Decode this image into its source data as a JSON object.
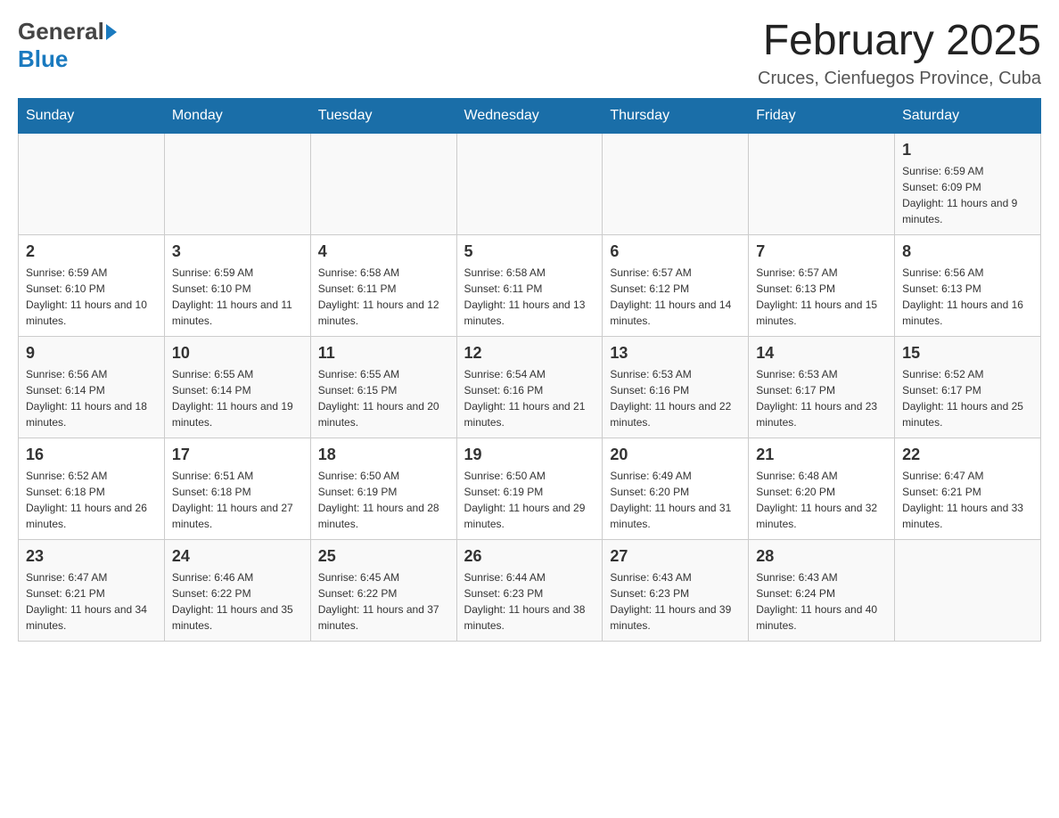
{
  "header": {
    "title": "February 2025",
    "subtitle": "Cruces, Cienfuegos Province, Cuba",
    "logo_general": "General",
    "logo_blue": "Blue"
  },
  "calendar": {
    "days_of_week": [
      "Sunday",
      "Monday",
      "Tuesday",
      "Wednesday",
      "Thursday",
      "Friday",
      "Saturday"
    ],
    "weeks": [
      [
        {
          "day": "",
          "info": ""
        },
        {
          "day": "",
          "info": ""
        },
        {
          "day": "",
          "info": ""
        },
        {
          "day": "",
          "info": ""
        },
        {
          "day": "",
          "info": ""
        },
        {
          "day": "",
          "info": ""
        },
        {
          "day": "1",
          "info": "Sunrise: 6:59 AM\nSunset: 6:09 PM\nDaylight: 11 hours and 9 minutes."
        }
      ],
      [
        {
          "day": "2",
          "info": "Sunrise: 6:59 AM\nSunset: 6:10 PM\nDaylight: 11 hours and 10 minutes."
        },
        {
          "day": "3",
          "info": "Sunrise: 6:59 AM\nSunset: 6:10 PM\nDaylight: 11 hours and 11 minutes."
        },
        {
          "day": "4",
          "info": "Sunrise: 6:58 AM\nSunset: 6:11 PM\nDaylight: 11 hours and 12 minutes."
        },
        {
          "day": "5",
          "info": "Sunrise: 6:58 AM\nSunset: 6:11 PM\nDaylight: 11 hours and 13 minutes."
        },
        {
          "day": "6",
          "info": "Sunrise: 6:57 AM\nSunset: 6:12 PM\nDaylight: 11 hours and 14 minutes."
        },
        {
          "day": "7",
          "info": "Sunrise: 6:57 AM\nSunset: 6:13 PM\nDaylight: 11 hours and 15 minutes."
        },
        {
          "day": "8",
          "info": "Sunrise: 6:56 AM\nSunset: 6:13 PM\nDaylight: 11 hours and 16 minutes."
        }
      ],
      [
        {
          "day": "9",
          "info": "Sunrise: 6:56 AM\nSunset: 6:14 PM\nDaylight: 11 hours and 18 minutes."
        },
        {
          "day": "10",
          "info": "Sunrise: 6:55 AM\nSunset: 6:14 PM\nDaylight: 11 hours and 19 minutes."
        },
        {
          "day": "11",
          "info": "Sunrise: 6:55 AM\nSunset: 6:15 PM\nDaylight: 11 hours and 20 minutes."
        },
        {
          "day": "12",
          "info": "Sunrise: 6:54 AM\nSunset: 6:16 PM\nDaylight: 11 hours and 21 minutes."
        },
        {
          "day": "13",
          "info": "Sunrise: 6:53 AM\nSunset: 6:16 PM\nDaylight: 11 hours and 22 minutes."
        },
        {
          "day": "14",
          "info": "Sunrise: 6:53 AM\nSunset: 6:17 PM\nDaylight: 11 hours and 23 minutes."
        },
        {
          "day": "15",
          "info": "Sunrise: 6:52 AM\nSunset: 6:17 PM\nDaylight: 11 hours and 25 minutes."
        }
      ],
      [
        {
          "day": "16",
          "info": "Sunrise: 6:52 AM\nSunset: 6:18 PM\nDaylight: 11 hours and 26 minutes."
        },
        {
          "day": "17",
          "info": "Sunrise: 6:51 AM\nSunset: 6:18 PM\nDaylight: 11 hours and 27 minutes."
        },
        {
          "day": "18",
          "info": "Sunrise: 6:50 AM\nSunset: 6:19 PM\nDaylight: 11 hours and 28 minutes."
        },
        {
          "day": "19",
          "info": "Sunrise: 6:50 AM\nSunset: 6:19 PM\nDaylight: 11 hours and 29 minutes."
        },
        {
          "day": "20",
          "info": "Sunrise: 6:49 AM\nSunset: 6:20 PM\nDaylight: 11 hours and 31 minutes."
        },
        {
          "day": "21",
          "info": "Sunrise: 6:48 AM\nSunset: 6:20 PM\nDaylight: 11 hours and 32 minutes."
        },
        {
          "day": "22",
          "info": "Sunrise: 6:47 AM\nSunset: 6:21 PM\nDaylight: 11 hours and 33 minutes."
        }
      ],
      [
        {
          "day": "23",
          "info": "Sunrise: 6:47 AM\nSunset: 6:21 PM\nDaylight: 11 hours and 34 minutes."
        },
        {
          "day": "24",
          "info": "Sunrise: 6:46 AM\nSunset: 6:22 PM\nDaylight: 11 hours and 35 minutes."
        },
        {
          "day": "25",
          "info": "Sunrise: 6:45 AM\nSunset: 6:22 PM\nDaylight: 11 hours and 37 minutes."
        },
        {
          "day": "26",
          "info": "Sunrise: 6:44 AM\nSunset: 6:23 PM\nDaylight: 11 hours and 38 minutes."
        },
        {
          "day": "27",
          "info": "Sunrise: 6:43 AM\nSunset: 6:23 PM\nDaylight: 11 hours and 39 minutes."
        },
        {
          "day": "28",
          "info": "Sunrise: 6:43 AM\nSunset: 6:24 PM\nDaylight: 11 hours and 40 minutes."
        },
        {
          "day": "",
          "info": ""
        }
      ]
    ]
  }
}
